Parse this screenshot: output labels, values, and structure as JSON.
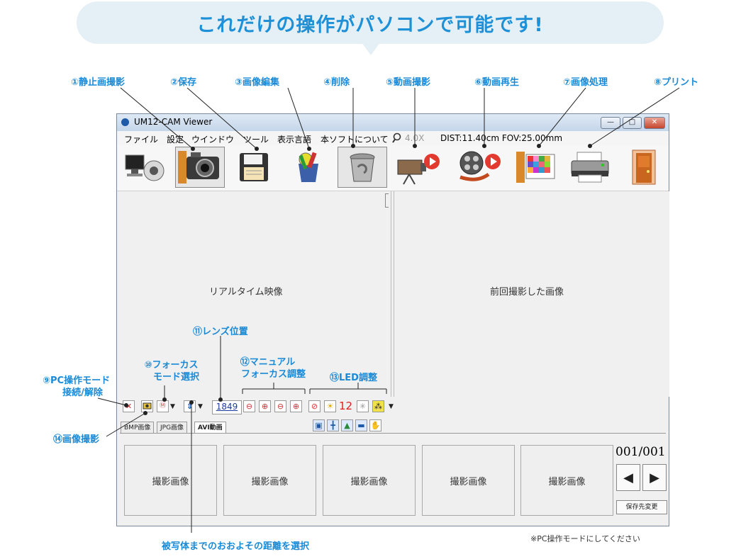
{
  "headline": "これだけの操作がパソコンで可能です!",
  "annotations": {
    "a1": "①静止画撮影",
    "a2": "②保存",
    "a3": "③画像編集",
    "a4": "④削除",
    "a5": "⑤動画撮影",
    "a6": "⑥動画再生",
    "a7": "⑦画像処理",
    "a8": "⑧プリント",
    "a9_l1": "⑨PC操作モード",
    "a9_l2": "接続/解除",
    "a10_l1": "⑩フォーカス",
    "a10_l2": "モード選択",
    "a11": "⑪レンズ位置",
    "a12_l1": "⑫マニュアル",
    "a12_l2": "フォーカス調整",
    "a13": "⑬LED調整",
    "a14": "⑭画像撮影",
    "distance": "被写体までのおおよその距離を選択",
    "note": "※PC操作モードにしてください"
  },
  "window": {
    "title": "UM12-CAM Viewer",
    "controls": {
      "minimize": "—",
      "maximize": "□",
      "close": "✕"
    }
  },
  "menu": {
    "file": "ファイル",
    "settings": "設定",
    "window": "ウインドウ",
    "tools": "ツール",
    "language": "表示言語",
    "about": "本ソフトについて",
    "zoom": "4.0X",
    "status": "DIST:11.40cm FOV:25.00mm"
  },
  "toolbar_icons": [
    "monitor-camera-icon",
    "camera-icon",
    "floppy-disk-icon",
    "paint-tools-icon",
    "trash-can-icon",
    "video-record-icon",
    "film-play-icon",
    "image-process-icon",
    "printer-icon",
    "exit-door-icon"
  ],
  "panes": {
    "left": "リアルタイム映像",
    "right": "前回撮影した画像"
  },
  "controls": {
    "lens_value": "1849",
    "led_value": "12"
  },
  "tabs": [
    "BMP画像",
    "JPG画像",
    "AVI動画"
  ],
  "thumbnails": [
    "撮影画像",
    "撮影画像",
    "撮影画像",
    "撮影画像",
    "撮影画像"
  ],
  "pager": "001/001",
  "save_dest": "保存先変更",
  "colors": {
    "accent": "#1a8ad6",
    "bubble": "#e4f0f6",
    "red": "#e02020"
  }
}
